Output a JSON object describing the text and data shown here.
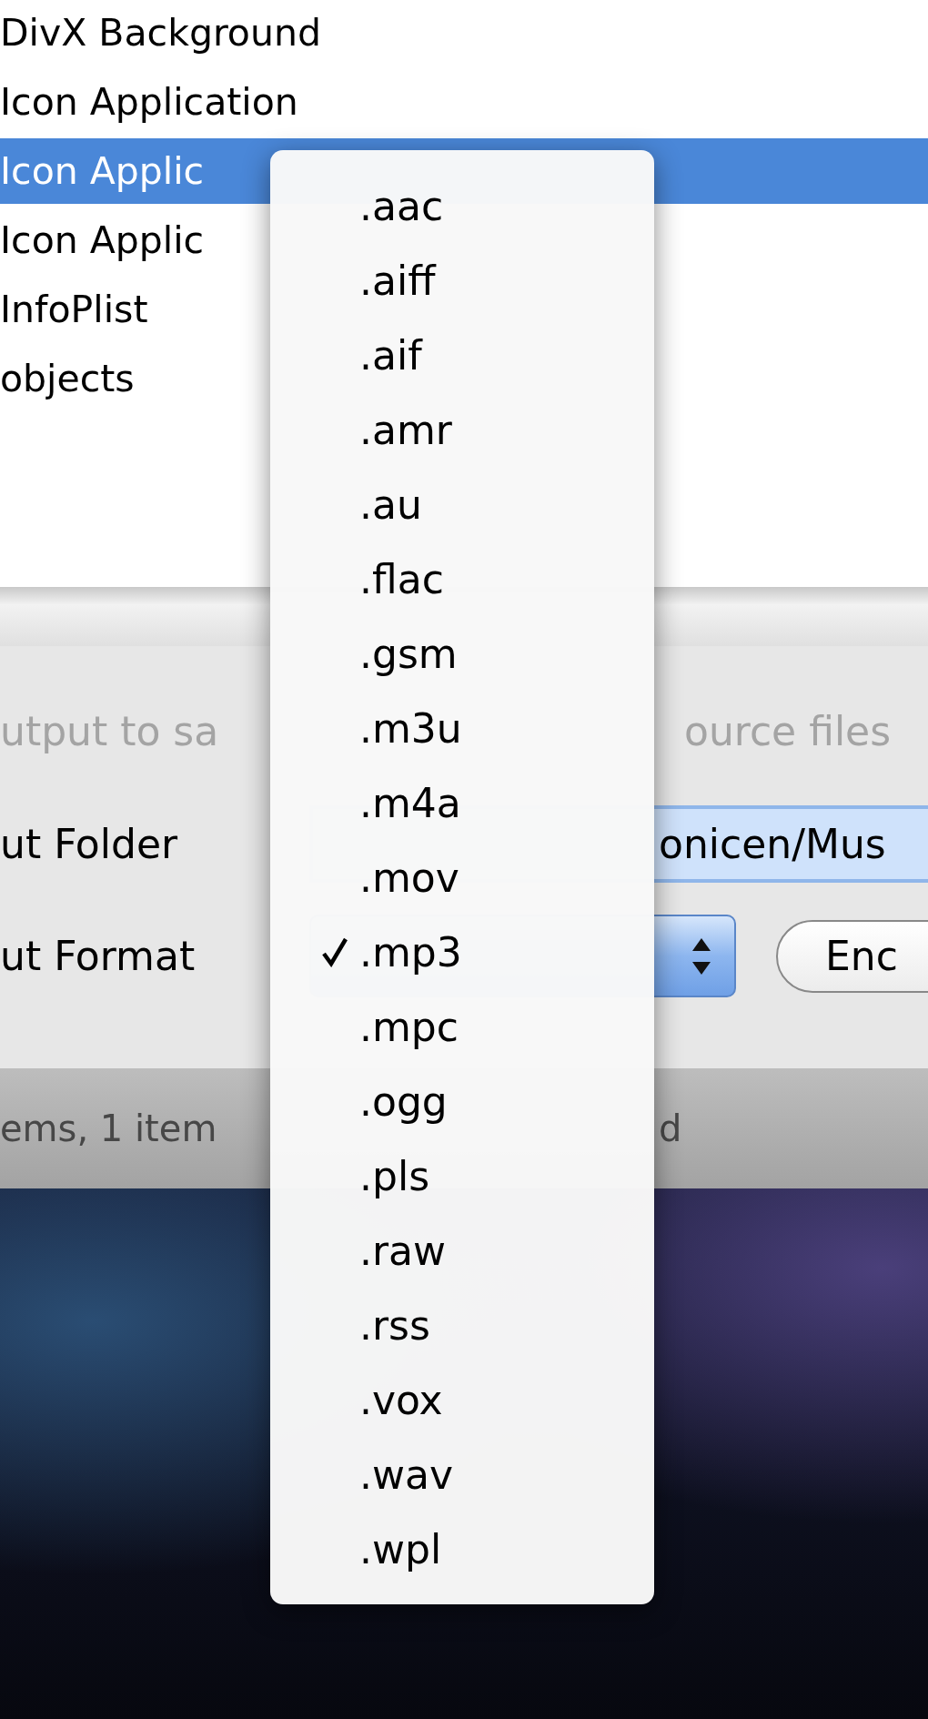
{
  "file_list": {
    "rows": [
      {
        "name": "DivX Background",
        "selected": false
      },
      {
        "name": "Icon Application",
        "selected": false
      },
      {
        "name": "Icon Applic",
        "selected": true
      },
      {
        "name": "Icon Applic",
        "selected": false
      },
      {
        "name": "InfoPlist",
        "selected": false
      },
      {
        "name": "objects",
        "selected": false
      }
    ]
  },
  "options": {
    "same_folder": {
      "text_left": "utput to sa",
      "text_right": "ource files",
      "disabled": true
    },
    "output_folder": {
      "label": "ut Folder",
      "value": "onicen/Mus"
    },
    "output_format": {
      "label": "ut Format"
    },
    "encode_button": "Enc"
  },
  "status_bar": {
    "text_left": "ems, 1 item",
    "text_right": "d"
  },
  "format_menu": {
    "items": [
      {
        "label": ".aac",
        "selected": false
      },
      {
        "label": ".aiff",
        "selected": false
      },
      {
        "label": ".aif",
        "selected": false
      },
      {
        "label": ".amr",
        "selected": false
      },
      {
        "label": ".au",
        "selected": false
      },
      {
        "label": ".flac",
        "selected": false
      },
      {
        "label": ".gsm",
        "selected": false
      },
      {
        "label": ".m3u",
        "selected": false
      },
      {
        "label": ".m4a",
        "selected": false
      },
      {
        "label": ".mov",
        "selected": false
      },
      {
        "label": ".mp3",
        "selected": true
      },
      {
        "label": ".mpc",
        "selected": false
      },
      {
        "label": ".ogg",
        "selected": false
      },
      {
        "label": ".pls",
        "selected": false
      },
      {
        "label": ".raw",
        "selected": false
      },
      {
        "label": ".rss",
        "selected": false
      },
      {
        "label": ".vox",
        "selected": false
      },
      {
        "label": ".wav",
        "selected": false
      },
      {
        "label": ".wpl",
        "selected": false
      }
    ]
  }
}
